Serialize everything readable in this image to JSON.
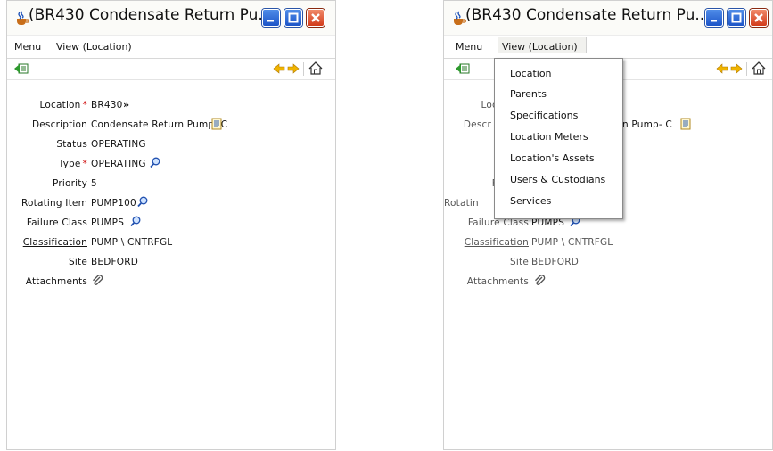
{
  "window": {
    "title": "(BR430 Condensate Return Pu...",
    "minimize_icon": "minimize-icon",
    "maximize_icon": "maximize-icon",
    "close_icon": "close-icon"
  },
  "menubar": {
    "menu_label": "Menu",
    "view_label": "View (Location)"
  },
  "toolbar": {
    "back_icon": "back-icon",
    "prev_icon": "previous-icon",
    "next_icon": "next-icon",
    "home_icon": "home-icon"
  },
  "form": {
    "fields": [
      {
        "label": "Location",
        "required": true,
        "value": "BR430",
        "icon": "detail-menu-icon"
      },
      {
        "label": "Description",
        "required": false,
        "value": "Condensate Return Pump- C",
        "icon": "long-description-icon"
      },
      {
        "label": "Status",
        "required": false,
        "value": "OPERATING"
      },
      {
        "label": "Type",
        "required": true,
        "value": "OPERATING",
        "icon": "lookup-icon"
      },
      {
        "label": "Priority",
        "required": false,
        "value": "5"
      },
      {
        "label": "Rotating Item",
        "required": false,
        "value": "PUMP100",
        "icon": "lookup-icon"
      },
      {
        "label": "Failure Class",
        "required": false,
        "value": "PUMPS",
        "icon": "lookup-icon"
      },
      {
        "label": "Classification",
        "required": false,
        "value": "PUMP \\ CNTRFGL",
        "link": true
      },
      {
        "label": "Site",
        "required": false,
        "value": "BEDFORD"
      },
      {
        "label": "Attachments",
        "required": false,
        "value": "",
        "icon": "attachment-icon"
      }
    ],
    "required_marker": "*"
  },
  "form2": {
    "loc_label": "Loc",
    "descr_label": "Descr",
    "descr_value": "n Pump- C",
    "f_label": "F",
    "rotating_label": "Rotatin",
    "failure_label": "Failure Class",
    "failure_value": "PUMPS",
    "classification_label": "Classification",
    "classification_value": "PUMP \\ CNTRFGL",
    "site_label": "Site",
    "site_value": "BEDFORD",
    "attachments_label": "Attachments"
  },
  "view_menu": {
    "items": [
      "Location",
      "Parents",
      "Specifications",
      "Location Meters",
      "Location's Assets",
      "Users & Custodians",
      "Services"
    ]
  },
  "colors": {
    "required": "#d01010",
    "dialog_border": "#8a8a8a"
  }
}
